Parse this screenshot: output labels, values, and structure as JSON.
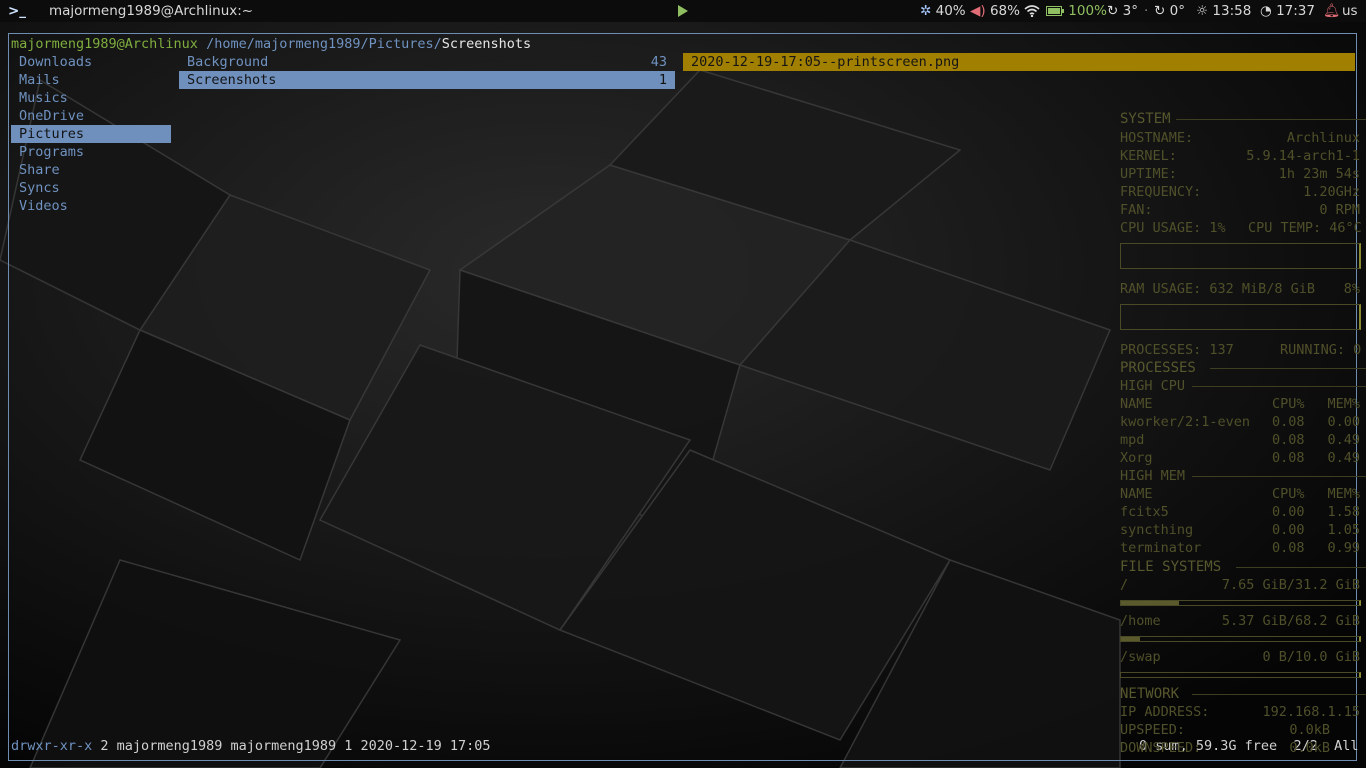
{
  "topbar": {
    "terminal_glyph": ">_",
    "window_title": "majormeng1989@Archlinux:~",
    "cpu": "40%",
    "volume": "68%",
    "battery": "100%",
    "temp1": "3°",
    "temp2": "0°",
    "sunrise": "13:58",
    "clock": "17:37",
    "layout": "us",
    "colors": {
      "volume": "#e06c75",
      "bell": "#e06c75",
      "battery": "#8fbf60"
    }
  },
  "ranger": {
    "prompt_userhost": "majormeng1989@Archlinux",
    "prompt_path": "/home/majormeng1989/Pictures/",
    "prompt_current": "Screenshots",
    "col1": [
      {
        "label": "Downloads"
      },
      {
        "label": "Mails"
      },
      {
        "label": "Musics"
      },
      {
        "label": "OneDrive"
      },
      {
        "label": "Pictures",
        "selected": true
      },
      {
        "label": "Programs"
      },
      {
        "label": "Share"
      },
      {
        "label": "Syncs"
      },
      {
        "label": "Videos"
      }
    ],
    "col2": [
      {
        "label": "Background",
        "count": "43"
      },
      {
        "label": "Screenshots",
        "count": "1",
        "selected": true
      }
    ],
    "col3_file": "2020-12-19-17:05--printscreen.png",
    "status_perms": "drwxr-xr-x",
    "status_info": "2 majormeng1989 majormeng1989 1 2020-12-19 17:05",
    "status_right": "0 sum, 59.3G free",
    "status_pos": "2/2",
    "status_all": "All"
  },
  "conky": {
    "system_title": "SYSTEM",
    "hostname_label": "HOSTNAME:",
    "hostname": "Archlinux",
    "kernel_label": "KERNEL:",
    "kernel": "5.9.14-arch1-1",
    "uptime_label": "UPTIME:",
    "uptime": "1h 23m 54s",
    "freq_label": "FREQUENCY:",
    "freq": "1.20GHz",
    "fan_label": "FAN:",
    "fan": "0 RPM",
    "cpu_usage": "CPU USAGE: 1%",
    "cpu_temp": "CPU TEMP: 46°C",
    "ram_usage": "RAM USAGE: 632 MiB/8 GiB",
    "ram_pct": "8%",
    "processes_label": "PROCESSES: 137",
    "running_label": "RUNNING: 0",
    "processes_title": "PROCESSES",
    "high_cpu_title": "HIGH CPU",
    "high_mem_title": "HIGH MEM",
    "col_name": "NAME",
    "col_cpu": "CPU%",
    "col_mem": "MEM%",
    "high_cpu": [
      {
        "name": "kworker/2:1-even",
        "cpu": "0.08",
        "mem": "0.00"
      },
      {
        "name": "mpd",
        "cpu": "0.08",
        "mem": "0.49"
      },
      {
        "name": "Xorg",
        "cpu": "0.08",
        "mem": "0.49"
      }
    ],
    "high_mem": [
      {
        "name": "fcitx5",
        "cpu": "0.00",
        "mem": "1.58"
      },
      {
        "name": "syncthing",
        "cpu": "0.00",
        "mem": "1.05"
      },
      {
        "name": "terminator",
        "cpu": "0.08",
        "mem": "0.99"
      }
    ],
    "fs_title": "FILE SYSTEMS",
    "fs": [
      {
        "mount": "/",
        "usage": "7.65 GiB/31.2 GiB",
        "fraction": 0.245
      },
      {
        "mount": "/home",
        "usage": "5.37 GiB/68.2 GiB",
        "fraction": 0.079
      },
      {
        "mount": "/swap",
        "usage": "0 B/10.0 GiB",
        "fraction": 0.0
      }
    ],
    "network_title": "NETWORK",
    "ip_label": "IP ADDRESS:",
    "ip": "192.168.1.15",
    "upspeed_label": "UPSPEED:",
    "upspeed": "0.0kB",
    "downspeed_label": "DOWNSPEED:",
    "downspeed": "0.0kB"
  }
}
